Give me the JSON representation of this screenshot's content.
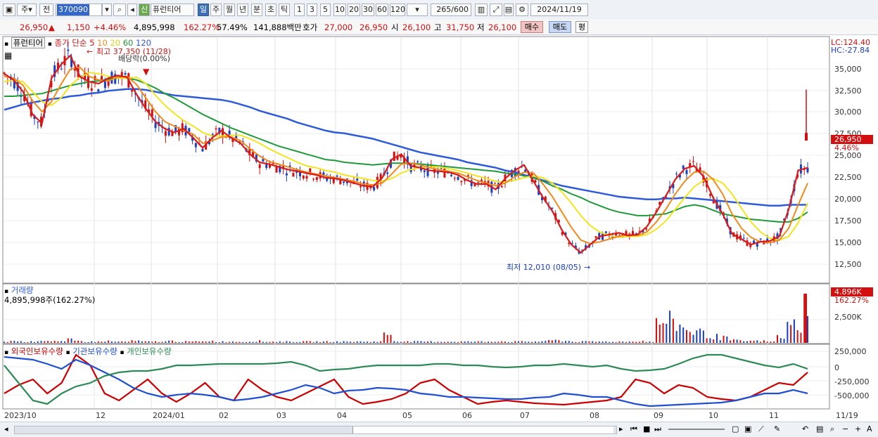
{
  "toolbar": {
    "market_type": "주",
    "prev_label": "전",
    "stock_code": "370090",
    "badge": "신",
    "stock_name": "퓨런티어",
    "periods": [
      "일",
      "주",
      "월",
      "년",
      "분",
      "초",
      "틱"
    ],
    "selected_period": "일",
    "intervals": [
      "1",
      "3",
      "5",
      "10",
      "20",
      "30",
      "60",
      "120"
    ],
    "count": "265",
    "count_total": "/600",
    "date": "2024/11/19"
  },
  "quote": {
    "price": "26,950",
    "change": "1,150",
    "change_pct": "+4.46%",
    "volume": "4,895,998",
    "volume_ratio": "162.27%",
    "turnover": "57.49%",
    "amount": "141,888백만",
    "ask_label": "호가",
    "ask": "27,000",
    "bid": "26,950",
    "open_label": "시",
    "open": "26,100",
    "high_label": "고",
    "high": "31,750",
    "low_label": "저",
    "low": "26,100",
    "buy": "매수",
    "sell": "매도",
    "eq": "평"
  },
  "price_panel": {
    "stock_tab": "퓨런티어",
    "ma_title": "종가 단순",
    "ma_periods": [
      {
        "label": "5",
        "color": "#d81c1c"
      },
      {
        "label": "10",
        "color": "#f08a1a"
      },
      {
        "label": "20",
        "color": "#f2e41e"
      },
      {
        "label": "60",
        "color": "#1f9a3a"
      },
      {
        "label": "120",
        "color": "#2e5bd8"
      }
    ],
    "high_note": "최고 37,350 (11/28)",
    "dividend_note": "배당락(0.00%)",
    "low_note": "최저 12,010 (08/05)",
    "lc_label": "LC:124.40",
    "hc_label": "HC:-27.84",
    "price_tag": "26,950",
    "pct_tag": "4.46%",
    "y_ticks": [
      "35,000",
      "32,500",
      "30,000",
      "27,500",
      "25,000",
      "22,500",
      "20,000",
      "17,500",
      "15,000",
      "12,500"
    ]
  },
  "volume_panel": {
    "title": "거래량",
    "value": "4,895,998주(162.27%)",
    "tag": "4.896K",
    "tag_pct": "162.27%",
    "y_tick": "2,500K"
  },
  "holding_panel": {
    "legend": [
      {
        "label": "외국인보유수량",
        "color": "#cc0000"
      },
      {
        "label": "기관보유수량",
        "color": "#2050d0"
      },
      {
        "label": "개인보유수량",
        "color": "#2e8b57"
      }
    ],
    "y_ticks": [
      "250,000",
      "0",
      "-250,000",
      "-500,000"
    ]
  },
  "x_axis": {
    "labels": [
      "2023/10",
      "12",
      "2024/01",
      "02",
      "03",
      "04",
      "05",
      "06",
      "07",
      "08",
      "09",
      "10",
      "11"
    ],
    "right_label": "11/19"
  },
  "chart_data": {
    "type": "line",
    "title": "퓨런티어",
    "x_range": [
      "2023/10",
      "2024/11/19"
    ],
    "ylim": [
      11500,
      37500
    ],
    "series": [
      {
        "name": "5",
        "values": [
          33500,
          32800,
          31500,
          29000,
          28000,
          33000,
          34500,
          35500,
          33200,
          32600,
          32400,
          33000,
          33300,
          33100,
          31200,
          29600,
          28200,
          27400,
          27000,
          27400,
          26400,
          25300,
          26400,
          27200,
          26400,
          25800,
          24600,
          23700,
          23500,
          23200,
          22900,
          22700,
          22500,
          22300,
          22000,
          21900,
          21700,
          21400,
          21100,
          21000,
          22000,
          24000,
          24600,
          23300,
          23100,
          22800,
          22700,
          22600,
          22300,
          21700,
          21300,
          21300,
          20700,
          21900,
          22800,
          23400,
          21600,
          19800,
          18300,
          16200,
          14600,
          13700,
          14600,
          15500,
          15700,
          15900,
          15600,
          15700,
          16600,
          18200,
          20000,
          21800,
          23000,
          23300,
          22100,
          19800,
          18000,
          15800,
          15200,
          14600,
          14900,
          15000,
          15500,
          18500,
          22800,
          23100
        ]
      },
      {
        "name": "10",
        "values": [
          33200,
          33000,
          32200,
          30500,
          29300,
          30400,
          32300,
          34000,
          34200,
          33200,
          32800,
          32700,
          33100,
          33200,
          32300,
          30800,
          29300,
          28200,
          27700,
          27200,
          26800,
          25800,
          26100,
          26500,
          26500,
          26100,
          25200,
          24400,
          23800,
          23500,
          23200,
          22900,
          22600,
          22400,
          22200,
          22000,
          21800,
          21600,
          21300,
          21200,
          21400,
          22400,
          23500,
          23600,
          23400,
          23100,
          22900,
          22700,
          22500,
          22100,
          21700,
          21400,
          21100,
          21400,
          22100,
          22600,
          22500,
          21300,
          19900,
          18200,
          16500,
          15100,
          14700,
          14900,
          15200,
          15500,
          15700,
          15600,
          16000,
          17100,
          18500,
          20200,
          21600,
          22600,
          22700,
          21800,
          20200,
          18000,
          16400,
          15400,
          14900,
          14800,
          15100,
          16400,
          19000,
          21400
        ]
      },
      {
        "name": "20",
        "values": [
          32600,
          32800,
          32600,
          31500,
          30400,
          30000,
          30800,
          32200,
          33100,
          33600,
          33500,
          33200,
          33000,
          33000,
          33100,
          32400,
          31100,
          30000,
          29100,
          28300,
          27700,
          27000,
          26600,
          26600,
          26700,
          26700,
          26300,
          25800,
          25200,
          24700,
          24200,
          23700,
          23300,
          23100,
          22800,
          22600,
          22300,
          22100,
          21900,
          21700,
          21600,
          21900,
          22500,
          22900,
          23100,
          23200,
          23200,
          23000,
          22800,
          22500,
          22200,
          21900,
          21600,
          21500,
          21700,
          22000,
          22200,
          22000,
          21400,
          20400,
          19200,
          17800,
          16700,
          16000,
          15600,
          15400,
          15500,
          15500,
          15700,
          16300,
          17200,
          18500,
          19800,
          21000,
          21700,
          21900,
          21400,
          20200,
          18600,
          17100,
          16000,
          15300,
          15100,
          15500,
          17000,
          19200
        ]
      },
      {
        "name": "60",
        "values": [
          31000,
          31000,
          31100,
          31200,
          31300,
          31600,
          31900,
          32200,
          32400,
          32600,
          32700,
          32900,
          33000,
          33000,
          32800,
          32400,
          31900,
          31300,
          30800,
          30200,
          29600,
          29000,
          28500,
          28000,
          27500,
          27100,
          26700,
          26300,
          25900,
          25500,
          25200,
          24900,
          24600,
          24300,
          24000,
          23900,
          23700,
          23600,
          23500,
          23400,
          23500,
          23600,
          23600,
          23600,
          23500,
          23400,
          23300,
          23200,
          23100,
          23000,
          22900,
          22800,
          22700,
          22500,
          22400,
          22200,
          22000,
          21600,
          21100,
          20700,
          20200,
          19800,
          19300,
          18900,
          18500,
          18200,
          18000,
          17800,
          17800,
          17900,
          18000,
          18400,
          18800,
          19000,
          18800,
          18400,
          18000,
          17800,
          17600,
          17400,
          17300,
          17200,
          17100,
          17100,
          17500,
          18200
        ]
      },
      {
        "name": "120",
        "values": [
          29500,
          29800,
          30100,
          30300,
          30500,
          30700,
          30800,
          31000,
          31100,
          31300,
          31400,
          31600,
          31700,
          31800,
          31800,
          31700,
          31500,
          31300,
          31100,
          31000,
          30900,
          30800,
          30700,
          30600,
          30400,
          30100,
          29800,
          29400,
          29100,
          28800,
          28500,
          28100,
          27800,
          27500,
          27200,
          27000,
          26900,
          26700,
          26500,
          26300,
          26000,
          25700,
          25400,
          25100,
          24800,
          24600,
          24400,
          24200,
          24000,
          23700,
          23500,
          23300,
          23100,
          22800,
          22600,
          22300,
          22000,
          21700,
          21400,
          21100,
          20900,
          20700,
          20500,
          20300,
          20100,
          19900,
          19800,
          19700,
          19600,
          19600,
          19700,
          19700,
          19800,
          19700,
          19600,
          19500,
          19400,
          19300,
          19200,
          19100,
          19000,
          18900,
          18900,
          19000,
          19000,
          19000
        ]
      }
    ],
    "volume_series": [
      2,
      3,
      2,
      2,
      4,
      3,
      2,
      5,
      3,
      2,
      2,
      3,
      2,
      2,
      3,
      2,
      2,
      2,
      3,
      2,
      2,
      2,
      3,
      2,
      2,
      2,
      2,
      3,
      2,
      2,
      2,
      2,
      2,
      2,
      2,
      2,
      2,
      2,
      2,
      2,
      2,
      15,
      3,
      2,
      2,
      2,
      2,
      2,
      2,
      2,
      2,
      2,
      2,
      3,
      2,
      2,
      2,
      2,
      3,
      4,
      3,
      2,
      2,
      2,
      2,
      2,
      2,
      2,
      3,
      2,
      30,
      35,
      30,
      22,
      18,
      14,
      10,
      8,
      4,
      3,
      3,
      3,
      2,
      10,
      25,
      30,
      80
    ]
  }
}
